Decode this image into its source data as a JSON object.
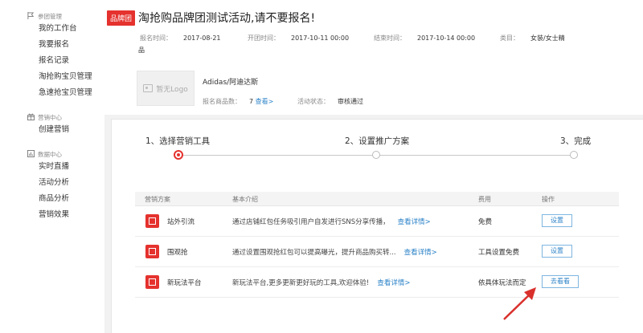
{
  "sidebar": {
    "groups": [
      {
        "title": "参团管理",
        "icon": "flag-icon",
        "items": [
          "我的工作台",
          "我要报名",
          "报名记录",
          "淘抢购宝贝管理",
          "急速抢宝贝管理"
        ]
      },
      {
        "title": "营销中心",
        "icon": "gift-icon",
        "items": [
          "创建营销"
        ]
      },
      {
        "title": "数据中心",
        "icon": "chart-icon",
        "items": [
          "实时直播",
          "活动分析",
          "商品分析",
          "营销效果"
        ]
      }
    ]
  },
  "header": {
    "tag": "品牌团",
    "title": "淘抢购品牌团测试活动,请不要报名!",
    "signup_time_label": "报名时间：",
    "signup_time": "2017-08-21",
    "start_time_label": "开团时间：",
    "start_time": "2017-10-11 00:00",
    "end_time_label": "结束时间：",
    "end_time": "2017-10-14 00:00",
    "category_label": "类目：",
    "category": "女装/女士精",
    "category_wrap": "品",
    "logo_placeholder": "暂无Logo",
    "brand_name": "Adidas/阿迪达斯",
    "signup_count_label": "报名商品数：",
    "signup_count": "7",
    "signup_count_link": "查看>",
    "status_label": "活动状态：",
    "status": "审核通过"
  },
  "steps": [
    {
      "label": "1、选择营销工具",
      "active": true
    },
    {
      "label": "2、设置推广方案",
      "active": false
    },
    {
      "label": "3、完成",
      "active": false
    }
  ],
  "table": {
    "headers": {
      "plan": "营销方案",
      "intro": "基本介绍",
      "fee": "费用",
      "op": "操作"
    },
    "rows": [
      {
        "name": "站外引流",
        "desc": "通过店铺红包任务吸引用户自发进行SNS分享传播，",
        "link": "查看详情>",
        "fee": "免费",
        "op": "设置"
      },
      {
        "name": "围观抢",
        "desc": "通过设置围观抢红包可以提高曝光，提升商品购买转...",
        "link": "查看详情>",
        "fee": "工具设置免费",
        "op": "设置"
      },
      {
        "name": "新玩法平台",
        "desc": "新玩法平台,更多更新更好玩的工具,欢迎体验!",
        "link": "查看详情>",
        "fee": "依具体玩法而定",
        "op": "去看看"
      }
    ]
  },
  "colors": {
    "accent": "#e5322e",
    "link": "#2c83c8"
  }
}
